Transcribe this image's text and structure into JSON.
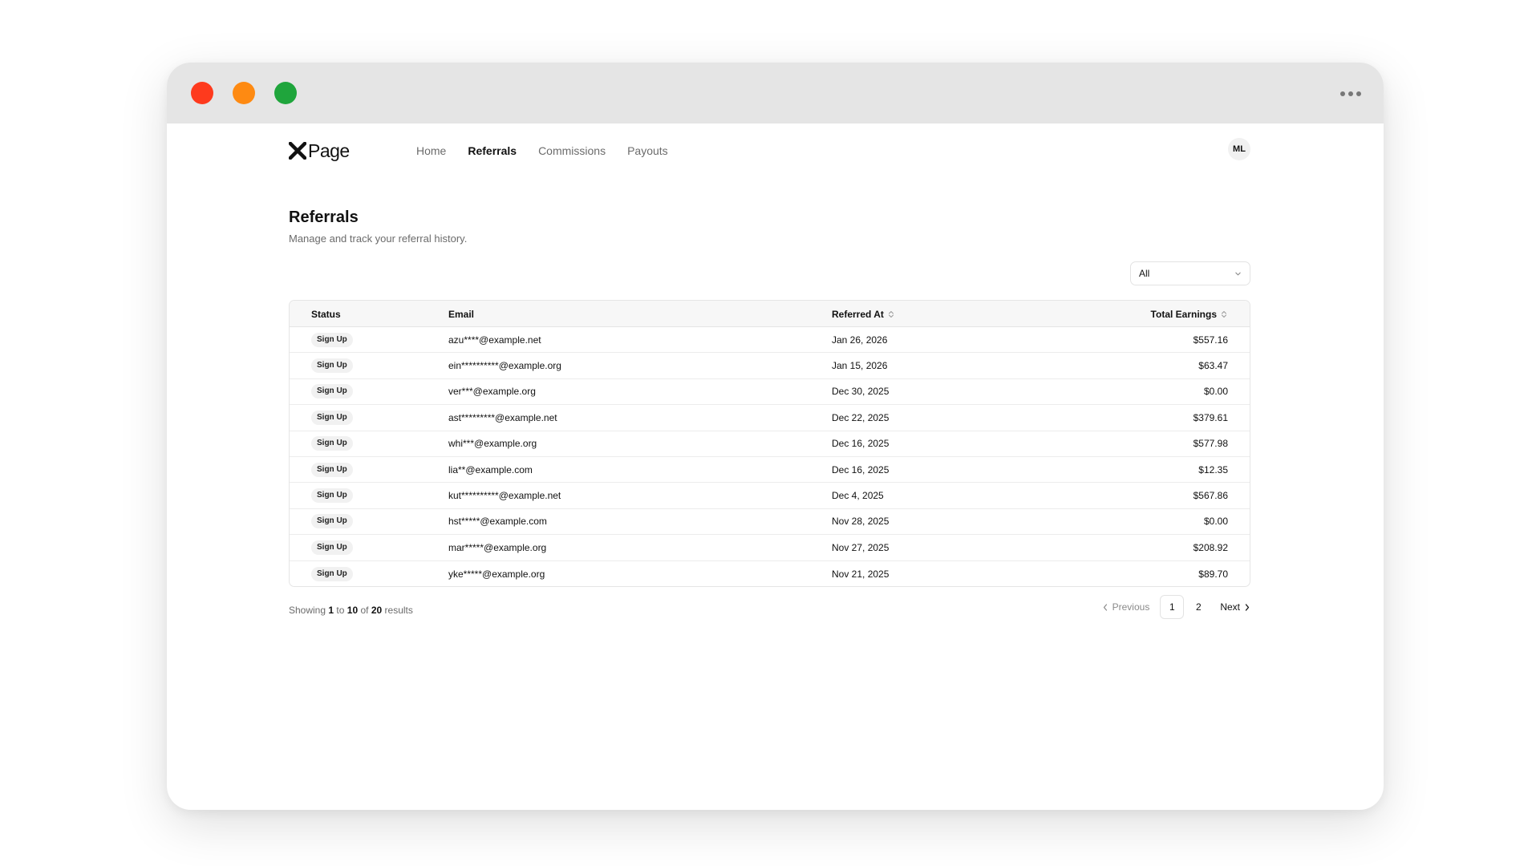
{
  "window": {
    "title_controls": {
      "close_color": "#fe3a1d",
      "minimize_color": "#fe8a12",
      "maximize_color": "#1fa53c"
    },
    "more_icon": "more-dots-icon"
  },
  "nav": {
    "logo_text": "Page",
    "logo_icon": "x-logo-icon",
    "links": [
      "Home",
      "Referrals",
      "Commissions",
      "Payouts"
    ],
    "active": "Referrals",
    "avatar_initials": "ML"
  },
  "page": {
    "title": "Referrals",
    "subtitle": "Manage and track your referral history."
  },
  "filter": {
    "selected": "All",
    "icon": "chevron-down-icon"
  },
  "table": {
    "headers": {
      "status": "Status",
      "email": "Email",
      "referred_at": "Referred At",
      "total_earnings": "Total Earnings"
    },
    "rows": [
      {
        "status": "Sign Up",
        "email": "azu****@example.net",
        "referred_at": "Jan 26, 2026",
        "earnings": "$557.16"
      },
      {
        "status": "Sign Up",
        "email": "ein**********@example.org",
        "referred_at": "Jan 15, 2026",
        "earnings": "$63.47"
      },
      {
        "status": "Sign Up",
        "email": "ver***@example.org",
        "referred_at": "Dec 30, 2025",
        "earnings": "$0.00"
      },
      {
        "status": "Sign Up",
        "email": "ast*********@example.net",
        "referred_at": "Dec 22, 2025",
        "earnings": "$379.61"
      },
      {
        "status": "Sign Up",
        "email": "whi***@example.org",
        "referred_at": "Dec 16, 2025",
        "earnings": "$577.98"
      },
      {
        "status": "Sign Up",
        "email": "lia**@example.com",
        "referred_at": "Dec 16, 2025",
        "earnings": "$12.35"
      },
      {
        "status": "Sign Up",
        "email": "kut**********@example.net",
        "referred_at": "Dec 4, 2025",
        "earnings": "$567.86"
      },
      {
        "status": "Sign Up",
        "email": "hst*****@example.com",
        "referred_at": "Nov 28, 2025",
        "earnings": "$0.00"
      },
      {
        "status": "Sign Up",
        "email": "mar*****@example.org",
        "referred_at": "Nov 27, 2025",
        "earnings": "$208.92"
      },
      {
        "status": "Sign Up",
        "email": "yke*****@example.org",
        "referred_at": "Nov 21, 2025",
        "earnings": "$89.70"
      }
    ]
  },
  "pagination": {
    "showing_prefix": "Showing",
    "from": "1",
    "to_word": "to",
    "to": "10",
    "of_word": "of",
    "total": "20",
    "results_word": "results",
    "previous": "Previous",
    "next": "Next",
    "pages": [
      "1",
      "2"
    ],
    "current_page": "1"
  }
}
